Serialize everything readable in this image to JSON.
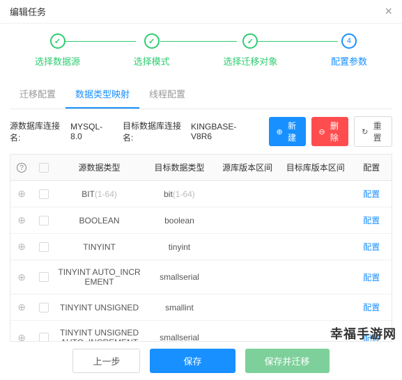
{
  "modal": {
    "title": "编辑任务"
  },
  "stepper": {
    "steps": [
      {
        "label": "选择数据源",
        "state": "done"
      },
      {
        "label": "选择模式",
        "state": "done"
      },
      {
        "label": "选择迁移对象",
        "state": "done"
      },
      {
        "label": "配置参数",
        "state": "active",
        "num": "4"
      }
    ]
  },
  "tabs": {
    "items": [
      "迁移配置",
      "数据类型映射",
      "线程配置"
    ],
    "active": 1
  },
  "toolbar": {
    "src_label": "源数据库连接名:",
    "src_name": "MYSQL-8.0",
    "tgt_label": "目标数据库连接名:",
    "tgt_name": "KINGBASE-V8R6",
    "new_btn": "新建",
    "delete_btn": "删除",
    "reset_btn": "重置"
  },
  "table": {
    "headers": {
      "src_type": "源数据类型",
      "tgt_type": "目标数据类型",
      "src_ver": "源库版本区间",
      "tgt_ver": "目标库版本区间",
      "op": "配置"
    },
    "op_link": "配置",
    "rows": [
      {
        "src": "BIT",
        "src_suffix": "(1-64)",
        "tgt": "bit",
        "tgt_suffix": "(1-64)"
      },
      {
        "src": "BOOLEAN",
        "tgt": "boolean"
      },
      {
        "src": "TINYINT",
        "tgt": "tinyint"
      },
      {
        "src": "TINYINT AUTO_INCREMENT",
        "tgt": "smallserial"
      },
      {
        "src": "TINYINT UNSIGNED",
        "tgt": "smallint"
      },
      {
        "src": "TINYINT UNSIGNED AUTO_INCREMENT",
        "tgt": "smallserial"
      }
    ]
  },
  "footer": {
    "prev": "上一步",
    "save": "保存",
    "save_migrate": "保存并迁移"
  },
  "watermark": "幸福手游网"
}
